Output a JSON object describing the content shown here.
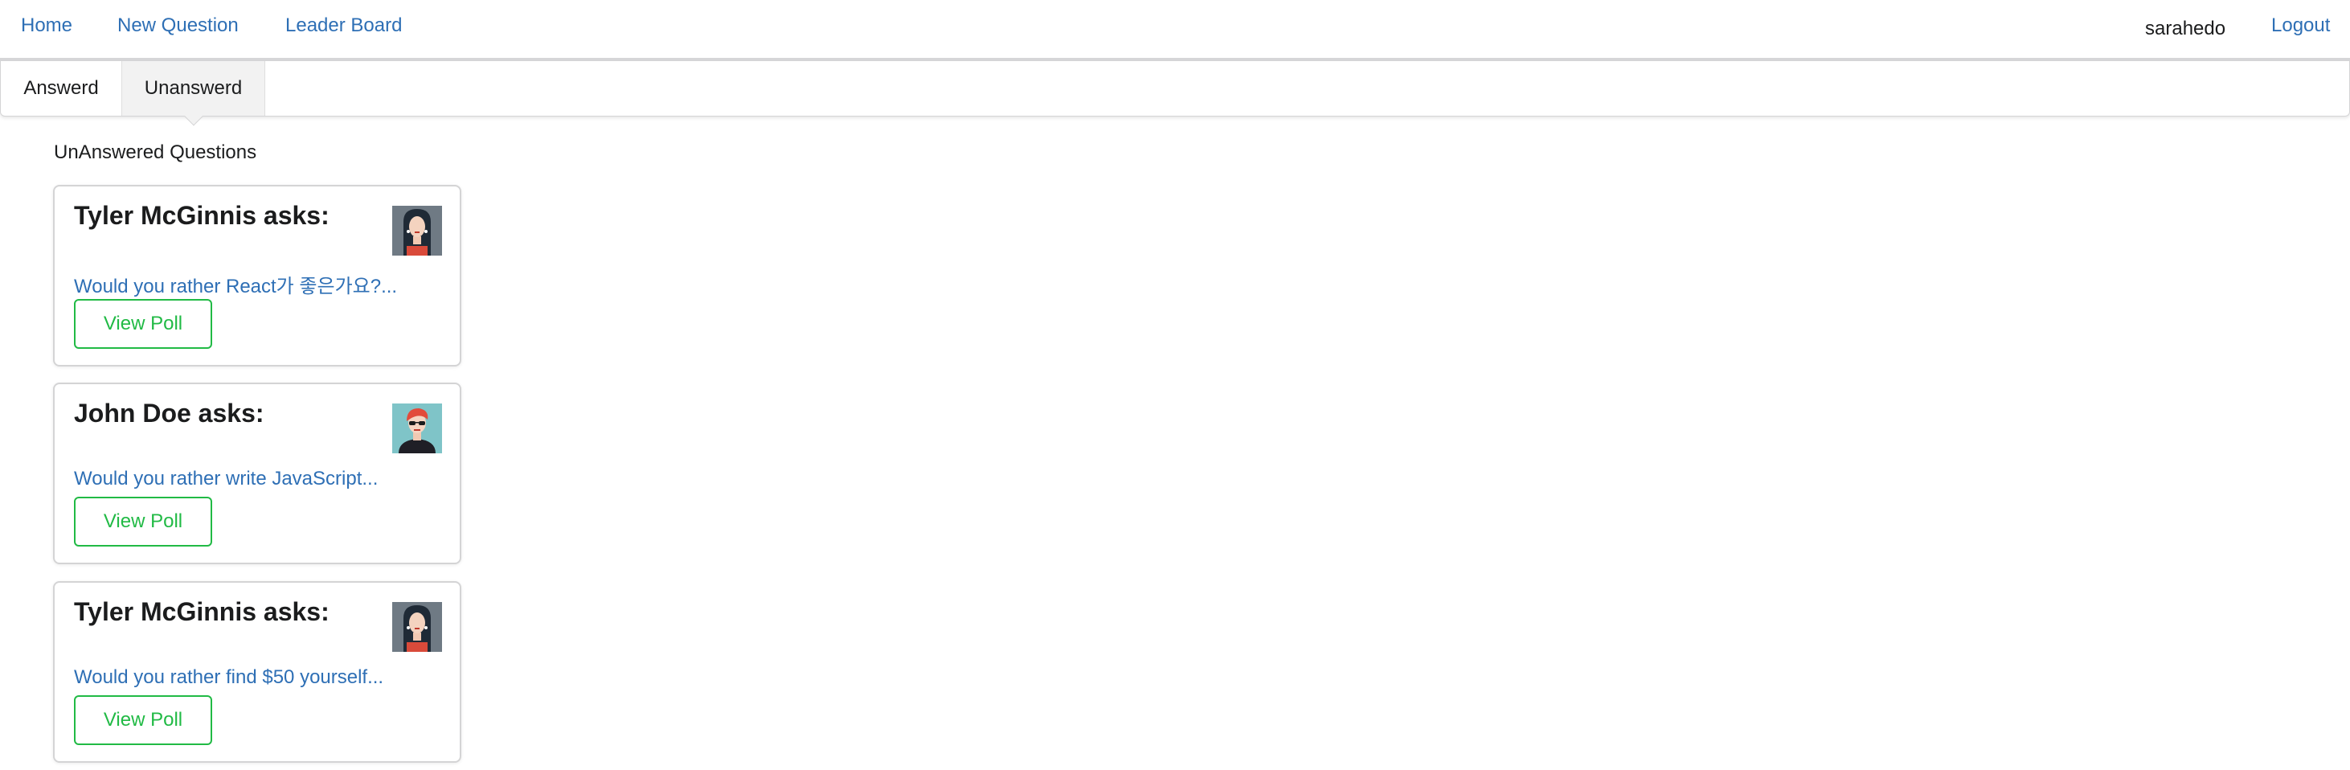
{
  "nav": {
    "home": "Home",
    "new_question": "New Question",
    "leader_board": "Leader Board",
    "username": "sarahedo",
    "logout": "Logout"
  },
  "tabs": [
    {
      "label": "Answerd",
      "active": false
    },
    {
      "label": "Unanswerd",
      "active": true
    }
  ],
  "section_title": "UnAnswered Questions",
  "questions": [
    {
      "asker": "Tyler McGinnis asks:",
      "text": "Would you rather React가 좋은가요?...",
      "button": "View Poll",
      "avatar": "woman-long-dark-hair-avatar"
    },
    {
      "asker": "John Doe asks:",
      "text": "Would you rather write JavaScript...",
      "button": "View Poll",
      "avatar": "woman-red-hair-glasses-avatar"
    },
    {
      "asker": "Tyler McGinnis asks:",
      "text": "Would you rather find $50 yourself...",
      "button": "View Poll",
      "avatar": "woman-long-dark-hair-avatar"
    }
  ],
  "colors": {
    "link": "#2e6fb5",
    "button": "#21ba45",
    "border": "#d4d4d5"
  }
}
